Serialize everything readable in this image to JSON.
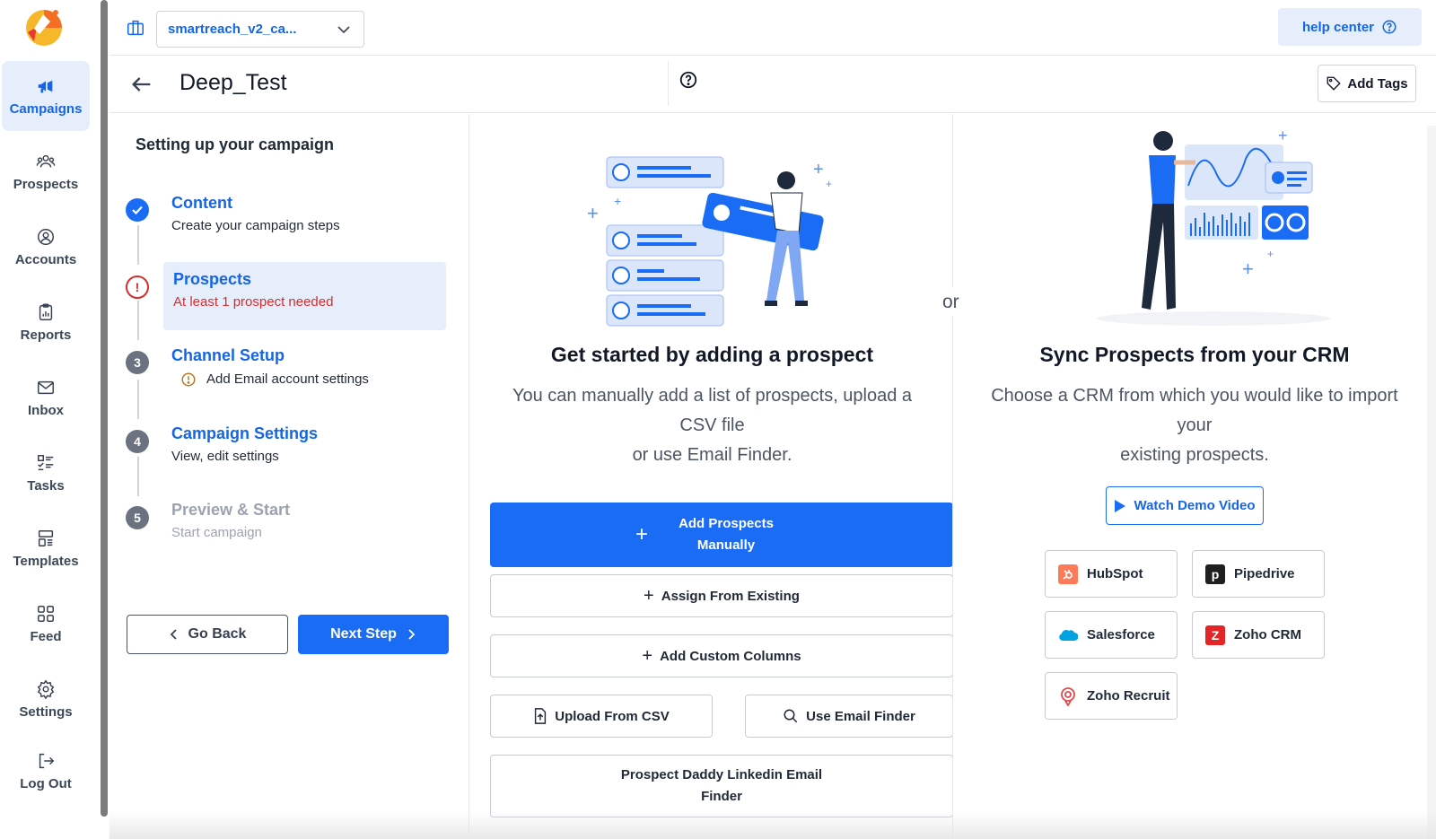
{
  "sidebar": {
    "items": [
      {
        "label": "Campaigns",
        "icon": "megaphone-icon",
        "active": true
      },
      {
        "label": "Prospects",
        "icon": "users-icon"
      },
      {
        "label": "Accounts",
        "icon": "user-circle-icon"
      },
      {
        "label": "Reports",
        "icon": "clipboard-chart-icon"
      },
      {
        "label": "Inbox",
        "icon": "mail-icon"
      },
      {
        "label": "Tasks",
        "icon": "task-list-icon"
      },
      {
        "label": "Templates",
        "icon": "template-icon"
      },
      {
        "label": "Feed",
        "icon": "grid-icon"
      },
      {
        "label": "Settings",
        "icon": "gear-icon"
      },
      {
        "label": "Log Out",
        "icon": "logout-icon"
      }
    ]
  },
  "topbar": {
    "workspace": "smartreach_v2_ca...",
    "help_label": "help center"
  },
  "campaign": {
    "title": "Deep_Test",
    "add_tags_label": "Add Tags"
  },
  "steps": {
    "heading": "Setting up your campaign",
    "list": [
      {
        "num": "",
        "title": "Content",
        "sub": "Create your campaign steps",
        "state": "done"
      },
      {
        "num": "!",
        "title": "Prospects",
        "sub": "At least 1 prospect needed",
        "state": "error"
      },
      {
        "num": "3",
        "title": "Channel Setup",
        "sub": "Add Email account settings",
        "state": "warning"
      },
      {
        "num": "4",
        "title": "Campaign Settings",
        "sub": "View, edit settings",
        "state": "todo"
      },
      {
        "num": "5",
        "title": "Preview & Start",
        "sub": "Start campaign",
        "state": "disabled"
      }
    ],
    "go_back": "Go Back",
    "next_step": "Next Step"
  },
  "add_panel": {
    "title": "Get started by adding a prospect",
    "desc_line1": "You can manually add a list of prospects, upload a",
    "desc_line2": "CSV file",
    "desc_line3": "or use Email Finder.",
    "add_manually_line1": "Add Prospects",
    "add_manually_line2": "Manually",
    "assign_existing": "Assign From Existing",
    "add_custom_columns": "Add Custom Columns",
    "upload_csv": "Upload From CSV",
    "email_finder": "Use Email Finder",
    "prospect_daddy_line1": "Prospect Daddy Linkedin Email",
    "prospect_daddy_line2": "Finder"
  },
  "or_label": "or",
  "crm_panel": {
    "title": "Sync Prospects from your CRM",
    "desc_line1": "Choose a CRM from which you would like to import",
    "desc_line2": "your",
    "desc_line3": "existing prospects.",
    "demo_label": "Watch Demo Video",
    "crms": [
      {
        "name": "HubSpot",
        "color": "#ff7a59"
      },
      {
        "name": "Pipedrive",
        "color": "#1f1f1f"
      },
      {
        "name": "Salesforce",
        "color": "#00a1e0"
      },
      {
        "name": "Zoho CRM",
        "color": "#e42527"
      },
      {
        "name": "Zoho Recruit",
        "color": "#e04a4a"
      }
    ]
  },
  "colors": {
    "primary": "#1a6cf5",
    "error": "#d32f2f",
    "warning": "#b7791f",
    "active_bg": "#e6eefc"
  }
}
